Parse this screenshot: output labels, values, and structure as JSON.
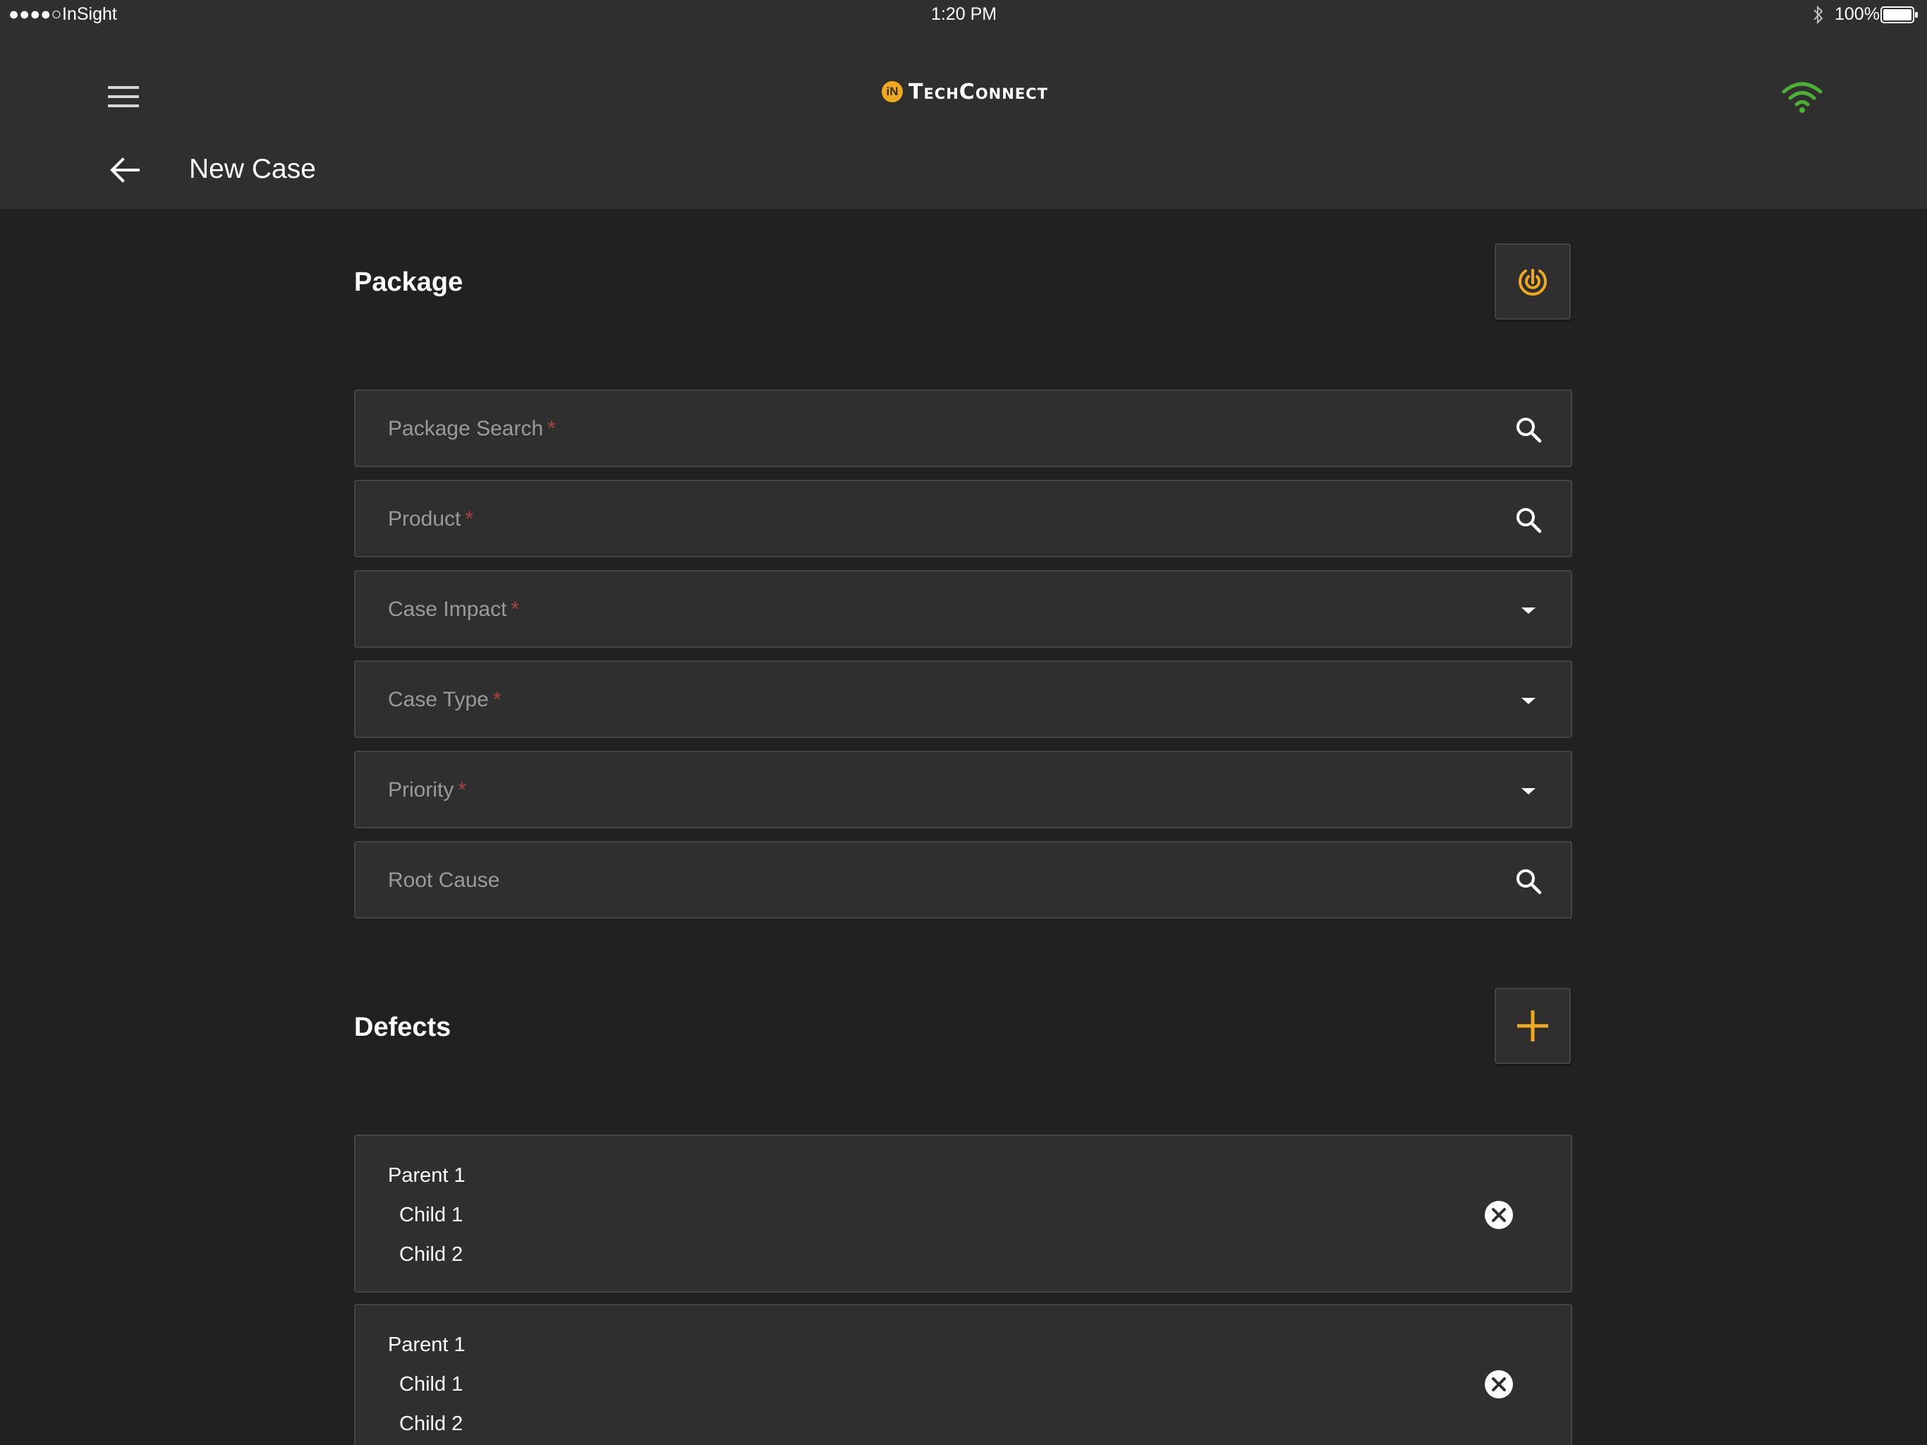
{
  "status_bar": {
    "signal": "●●●●○",
    "carrier": "InSight",
    "time": "1:20 PM",
    "battery": "100%"
  },
  "header": {
    "logo_badge": "iN",
    "logo_text": "TechConnect",
    "page_title": "New Case"
  },
  "package": {
    "title": "Package",
    "fields": [
      {
        "label": "Package Search",
        "required": "*",
        "icon": "search-icon"
      },
      {
        "label": "Product",
        "required": "*",
        "icon": "search-icon"
      },
      {
        "label": "Case Impact",
        "required": "*",
        "icon": "dropdown-icon"
      },
      {
        "label": "Case Type",
        "required": "*",
        "icon": "dropdown-icon"
      },
      {
        "label": "Priority",
        "required": "*",
        "icon": "dropdown-icon"
      },
      {
        "label": "Root Cause",
        "required": "",
        "icon": "search-icon"
      }
    ]
  },
  "defects": {
    "title": "Defects",
    "items": [
      {
        "parent": "Parent 1",
        "children": [
          "Child 1",
          "Child 2"
        ]
      },
      {
        "parent": "Parent 1",
        "children": [
          "Child 1",
          "Child 2"
        ]
      }
    ]
  },
  "colors": {
    "accent": "#f0a91e",
    "wifi": "#4cb034",
    "required": "#a8433f",
    "surface": "#2f2f2f",
    "background": "#212121"
  }
}
